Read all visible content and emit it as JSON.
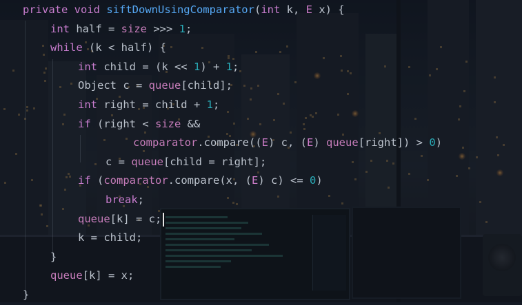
{
  "editor": {
    "lines": [
      {
        "indent": 0,
        "tokens": [
          {
            "t": "private ",
            "c": "kw"
          },
          {
            "t": "void ",
            "c": "kw"
          },
          {
            "t": "siftDownUsingComparator",
            "c": "fn"
          },
          {
            "t": "(",
            "c": "txt"
          },
          {
            "t": "int ",
            "c": "kw"
          },
          {
            "t": "k, ",
            "c": "txt"
          },
          {
            "t": "E ",
            "c": "ty"
          },
          {
            "t": "x) {",
            "c": "txt"
          }
        ]
      },
      {
        "indent": 1,
        "tokens": [
          {
            "t": "int ",
            "c": "kw"
          },
          {
            "t": "half = ",
            "c": "txt"
          },
          {
            "t": "size",
            "c": "fld"
          },
          {
            "t": " >>> ",
            "c": "txt"
          },
          {
            "t": "1",
            "c": "num"
          },
          {
            "t": ";",
            "c": "txt"
          }
        ]
      },
      {
        "indent": 1,
        "tokens": [
          {
            "t": "while ",
            "c": "kw"
          },
          {
            "t": "(k < half) {",
            "c": "txt"
          }
        ]
      },
      {
        "indent": 2,
        "tokens": [
          {
            "t": "int ",
            "c": "kw"
          },
          {
            "t": "child = (k << ",
            "c": "txt"
          },
          {
            "t": "1",
            "c": "num"
          },
          {
            "t": ") + ",
            "c": "txt"
          },
          {
            "t": "1",
            "c": "num"
          },
          {
            "t": ";",
            "c": "txt"
          }
        ]
      },
      {
        "indent": 2,
        "tokens": [
          {
            "t": "Object c = ",
            "c": "txt"
          },
          {
            "t": "queue",
            "c": "fld"
          },
          {
            "t": "[child];",
            "c": "txt"
          }
        ]
      },
      {
        "indent": 2,
        "tokens": [
          {
            "t": "int ",
            "c": "kw"
          },
          {
            "t": "right = child + ",
            "c": "txt"
          },
          {
            "t": "1",
            "c": "num"
          },
          {
            "t": ";",
            "c": "txt"
          }
        ]
      },
      {
        "indent": 2,
        "tokens": [
          {
            "t": "if ",
            "c": "kw"
          },
          {
            "t": "(right < ",
            "c": "txt"
          },
          {
            "t": "size",
            "c": "fld"
          },
          {
            "t": " &&",
            "c": "txt"
          }
        ]
      },
      {
        "indent": 4,
        "tokens": [
          {
            "t": "comparator",
            "c": "fld"
          },
          {
            "t": ".compare((",
            "c": "txt"
          },
          {
            "t": "E",
            "c": "ty"
          },
          {
            "t": ") c, (",
            "c": "txt"
          },
          {
            "t": "E",
            "c": "ty"
          },
          {
            "t": ") ",
            "c": "txt"
          },
          {
            "t": "queue",
            "c": "fld"
          },
          {
            "t": "[right]) > ",
            "c": "txt"
          },
          {
            "t": "0",
            "c": "num"
          },
          {
            "t": ")",
            "c": "txt"
          }
        ]
      },
      {
        "indent": 3,
        "tokens": [
          {
            "t": "c = ",
            "c": "txt"
          },
          {
            "t": "queue",
            "c": "fld"
          },
          {
            "t": "[child = right];",
            "c": "txt"
          }
        ]
      },
      {
        "indent": 2,
        "tokens": [
          {
            "t": "if ",
            "c": "kw"
          },
          {
            "t": "(",
            "c": "txt"
          },
          {
            "t": "comparator",
            "c": "fld"
          },
          {
            "t": ".compare(x, (",
            "c": "txt"
          },
          {
            "t": "E",
            "c": "ty"
          },
          {
            "t": ") c) <= ",
            "c": "txt"
          },
          {
            "t": "0",
            "c": "num"
          },
          {
            "t": ")",
            "c": "txt"
          }
        ]
      },
      {
        "indent": 3,
        "tokens": [
          {
            "t": "break",
            "c": "kw"
          },
          {
            "t": ";",
            "c": "txt"
          }
        ]
      },
      {
        "indent": 2,
        "tokens": [
          {
            "t": "queue",
            "c": "fld"
          },
          {
            "t": "[k] = c;",
            "c": "txt"
          }
        ]
      },
      {
        "indent": 2,
        "tokens": [
          {
            "t": "k = child;",
            "c": "txt"
          }
        ]
      },
      {
        "indent": 1,
        "tokens": [
          {
            "t": "}",
            "c": "txt"
          }
        ]
      },
      {
        "indent": 1,
        "tokens": [
          {
            "t": "queue",
            "c": "fld"
          },
          {
            "t": "[k] = x;",
            "c": "txt"
          }
        ]
      },
      {
        "indent": 0,
        "tokens": [
          {
            "t": "}",
            "c": "txt"
          }
        ]
      }
    ],
    "cursor_line": 11,
    "colors": {
      "keyword": "#c97dcf",
      "function": "#56a8f5",
      "field": "#c77dbb",
      "number": "#2aacb8",
      "text": "#bcc3cd"
    }
  }
}
